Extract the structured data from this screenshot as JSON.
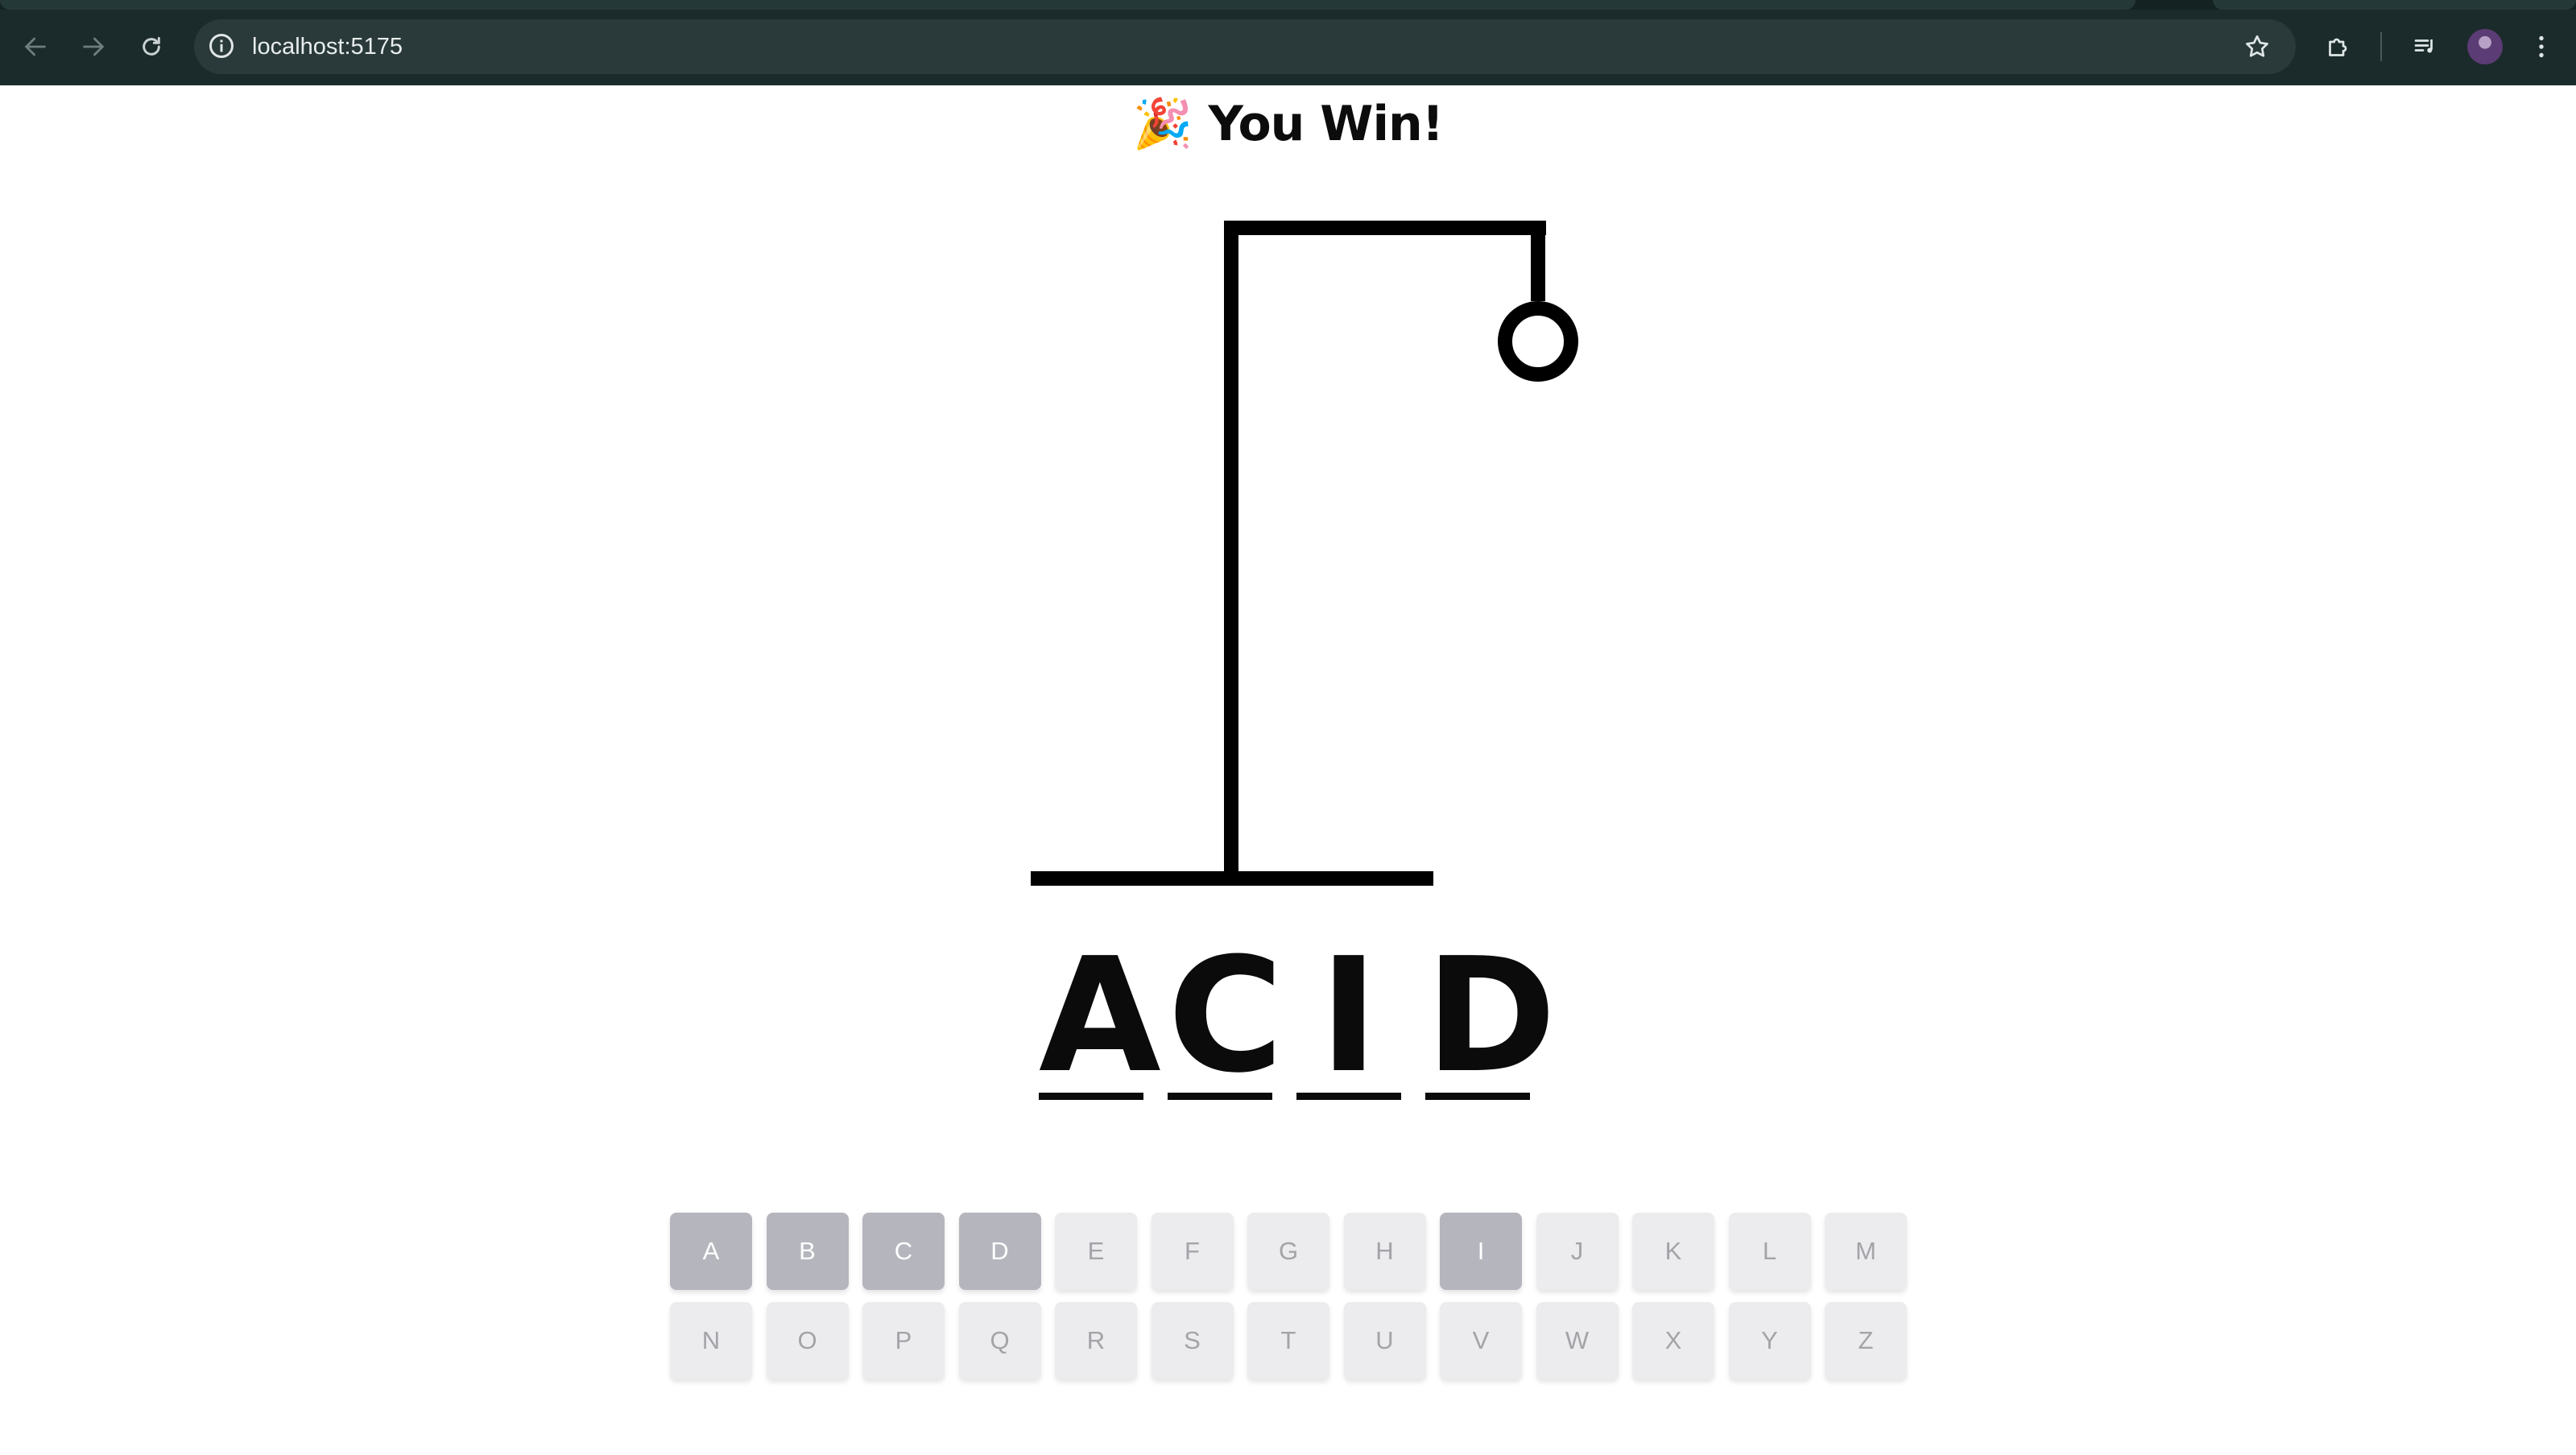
{
  "browser": {
    "url": "localhost:5175",
    "back_icon": "arrow-left-icon",
    "forward_icon": "arrow-right-icon",
    "reload_icon": "reload-icon"
  },
  "game": {
    "result_emoji": "🎉",
    "result_text": "You Win!",
    "word": [
      {
        "letter": "A"
      },
      {
        "letter": "C"
      },
      {
        "letter": "I"
      },
      {
        "letter": "D"
      }
    ],
    "keys": [
      {
        "label": "A",
        "used": true
      },
      {
        "label": "B",
        "used": true
      },
      {
        "label": "C",
        "used": true
      },
      {
        "label": "D",
        "used": true
      },
      {
        "label": "E",
        "used": false
      },
      {
        "label": "F",
        "used": false
      },
      {
        "label": "G",
        "used": false
      },
      {
        "label": "H",
        "used": false
      },
      {
        "label": "I",
        "used": true
      },
      {
        "label": "J",
        "used": false
      },
      {
        "label": "K",
        "used": false
      },
      {
        "label": "L",
        "used": false
      },
      {
        "label": "M",
        "used": false
      },
      {
        "label": "N",
        "used": false
      },
      {
        "label": "O",
        "used": false
      },
      {
        "label": "P",
        "used": false
      },
      {
        "label": "Q",
        "used": false
      },
      {
        "label": "R",
        "used": false
      },
      {
        "label": "S",
        "used": false
      },
      {
        "label": "T",
        "used": false
      },
      {
        "label": "U",
        "used": false
      },
      {
        "label": "V",
        "used": false
      },
      {
        "label": "W",
        "used": false
      },
      {
        "label": "X",
        "used": false
      },
      {
        "label": "Y",
        "used": false
      },
      {
        "label": "Z",
        "used": false
      }
    ],
    "wrong_guesses": 1
  },
  "colors": {
    "chrome_bg": "#1b2b2b",
    "key_used": "#b5b6bd",
    "key_unused": "#ececef",
    "ink": "#0b0b0b"
  }
}
